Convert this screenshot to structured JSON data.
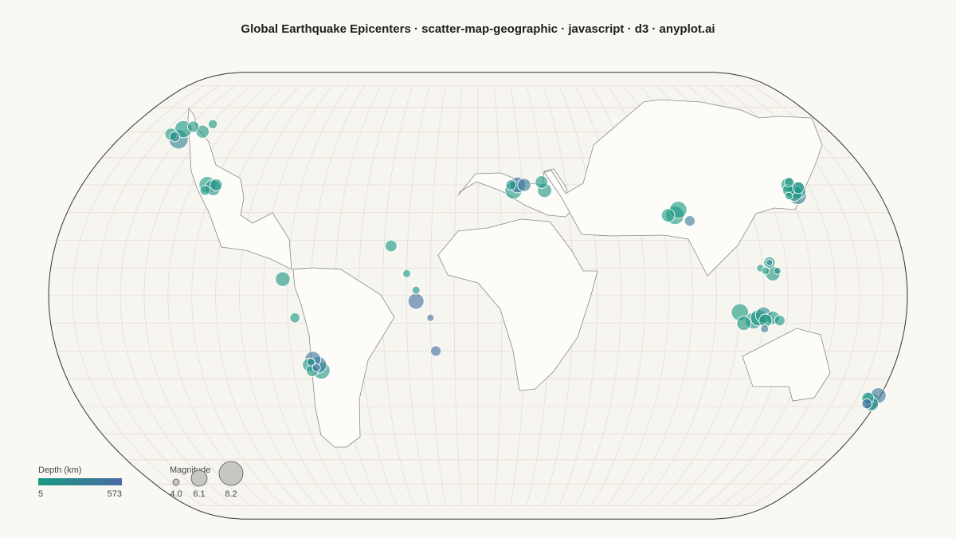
{
  "title": "Global Earthquake Epicenters · scatter-map-geographic · javascript · d3 · anyplot.ai",
  "colors": {
    "background": "#faf8f3",
    "sphere_fill": "#f7f5ef",
    "land_fill": "#fdfcf8",
    "land_stroke": "#8a8a8a",
    "graticule": "#e2dfd6",
    "outline": "#333333",
    "depth_shallow": "#1a9a80",
    "depth_deep": "#4a6aa6"
  },
  "legend": {
    "depth": {
      "title": "Depth (km)",
      "min_label": "5",
      "max_label": "573"
    },
    "magnitude": {
      "title": "Magnitude",
      "labels": [
        "4.0",
        "6.1",
        "8.2"
      ],
      "values": [
        4.0,
        6.1,
        8.2
      ]
    }
  },
  "chart_data": {
    "type": "scatter-map",
    "projection": "Natural Earth",
    "graticule": true,
    "depth_range": [
      5,
      573
    ],
    "magnitude_range": [
      4.0,
      8.2
    ],
    "points": [
      {
        "lon": -152,
        "lat": 61,
        "mag": 6.6,
        "depth": 30
      },
      {
        "lon": -148,
        "lat": 62,
        "mag": 5.2,
        "depth": 60
      },
      {
        "lon": -150,
        "lat": 57,
        "mag": 7.1,
        "depth": 250
      },
      {
        "lon": -156,
        "lat": 59,
        "mag": 5.4,
        "depth": 20
      },
      {
        "lon": -141,
        "lat": 60,
        "mag": 5.6,
        "depth": 35
      },
      {
        "lon": -139,
        "lat": 63,
        "mag": 4.7,
        "depth": 40
      },
      {
        "lon": -153,
        "lat": 58,
        "mag": 4.9,
        "depth": 150
      },
      {
        "lon": -123,
        "lat": 40,
        "mag": 6.5,
        "depth": 20
      },
      {
        "lon": -120,
        "lat": 39,
        "mag": 6.3,
        "depth": 160
      },
      {
        "lon": -119,
        "lat": 40,
        "mag": 5.4,
        "depth": 50
      },
      {
        "lon": -123,
        "lat": 38,
        "mag": 4.9,
        "depth": 12
      },
      {
        "lon": -37,
        "lat": 18,
        "mag": 5.3,
        "depth": 40
      },
      {
        "lon": -82,
        "lat": 6,
        "mag": 6.0,
        "depth": 80
      },
      {
        "lon": -77,
        "lat": -8,
        "mag": 4.9,
        "depth": 40
      },
      {
        "lon": -73,
        "lat": -25,
        "mag": 5.6,
        "depth": 100
      },
      {
        "lon": -71,
        "lat": -23,
        "mag": 6.3,
        "depth": 400
      },
      {
        "lon": -72,
        "lat": -27,
        "mag": 5.4,
        "depth": 30
      },
      {
        "lon": -68,
        "lat": -27,
        "mag": 6.6,
        "depth": 80
      },
      {
        "lon": -69,
        "lat": -25,
        "mag": 6.5,
        "depth": 350
      },
      {
        "lon": -70,
        "lat": -26,
        "mag": 4.4,
        "depth": 450
      },
      {
        "lon": -72,
        "lat": -24,
        "mag": 4.4,
        "depth": 120
      },
      {
        "lon": -30,
        "lat": 8,
        "mag": 4.4,
        "depth": 20
      },
      {
        "lon": -26,
        "lat": 2,
        "mag": 4.4,
        "depth": 50
      },
      {
        "lon": -26,
        "lat": -2,
        "mag": 6.3,
        "depth": 500
      },
      {
        "lon": -20,
        "lat": -8,
        "mag": 4.2,
        "depth": 520
      },
      {
        "lon": -18,
        "lat": -20,
        "mag": 5.0,
        "depth": 480
      },
      {
        "lon": 16,
        "lat": 38,
        "mag": 6.6,
        "depth": 30
      },
      {
        "lon": 18,
        "lat": 40,
        "mag": 6.3,
        "depth": 450
      },
      {
        "lon": 21,
        "lat": 40,
        "mag": 5.6,
        "depth": 350
      },
      {
        "lon": 29,
        "lat": 41,
        "mag": 5.5,
        "depth": 40
      },
      {
        "lon": 30,
        "lat": 38,
        "mag": 5.9,
        "depth": 60
      },
      {
        "lon": 15,
        "lat": 40,
        "mag": 4.9,
        "depth": 25
      },
      {
        "lon": 86,
        "lat": 29,
        "mag": 6.9,
        "depth": 40
      },
      {
        "lon": 88,
        "lat": 31,
        "mag": 6.6,
        "depth": 20
      },
      {
        "lon": 83,
        "lat": 29,
        "mag": 5.7,
        "depth": 15
      },
      {
        "lon": 92,
        "lat": 27,
        "mag": 5.0,
        "depth": 420
      },
      {
        "lon": 140,
        "lat": 38,
        "mag": 5.4,
        "depth": 40
      },
      {
        "lon": 142,
        "lat": 37,
        "mag": 6.3,
        "depth": 70
      },
      {
        "lon": 143,
        "lat": 36,
        "mag": 6.6,
        "depth": 300
      },
      {
        "lon": 144,
        "lat": 38,
        "mag": 6.5,
        "depth": 60
      },
      {
        "lon": 141,
        "lat": 40,
        "mag": 6.0,
        "depth": 30
      },
      {
        "lon": 145,
        "lat": 39,
        "mag": 5.3,
        "depth": 90
      },
      {
        "lon": 142,
        "lat": 41,
        "mag": 4.7,
        "depth": 20
      },
      {
        "lon": 139,
        "lat": 36,
        "mag": 4.3,
        "depth": 50
      },
      {
        "lon": 119,
        "lat": 10,
        "mag": 4.3,
        "depth": 40
      },
      {
        "lon": 121,
        "lat": 9,
        "mag": 4.3,
        "depth": 80
      },
      {
        "lon": 123,
        "lat": 12,
        "mag": 5.2,
        "depth": 60
      },
      {
        "lon": 124,
        "lat": 8,
        "mag": 6.0,
        "depth": 30
      },
      {
        "lon": 123,
        "lat": 12,
        "mag": 4.0,
        "depth": 300
      },
      {
        "lon": 126,
        "lat": 9,
        "mag": 4.2,
        "depth": 100
      },
      {
        "lon": 110,
        "lat": -6,
        "mag": 6.6,
        "depth": 20
      },
      {
        "lon": 112,
        "lat": -10,
        "mag": 5.9,
        "depth": 30
      },
      {
        "lon": 116,
        "lat": -9,
        "mag": 6.5,
        "depth": 70
      },
      {
        "lon": 118,
        "lat": -8,
        "mag": 6.4,
        "depth": 50
      },
      {
        "lon": 120,
        "lat": -7,
        "mag": 6.3,
        "depth": 150
      },
      {
        "lon": 121,
        "lat": -9,
        "mag": 5.6,
        "depth": 40
      },
      {
        "lon": 124,
        "lat": -8,
        "mag": 5.7,
        "depth": 60
      },
      {
        "lon": 121,
        "lat": -12,
        "mag": 4.4,
        "depth": 400
      },
      {
        "lon": 127,
        "lat": -9,
        "mag": 5.0,
        "depth": 30
      },
      {
        "lon": 175,
        "lat": -37,
        "mag": 5.4,
        "depth": 30
      },
      {
        "lon": 177,
        "lat": -38,
        "mag": 6.6,
        "depth": 80
      },
      {
        "lon": 179,
        "lat": -36,
        "mag": 6.2,
        "depth": 400
      },
      {
        "lon": 178,
        "lat": -39,
        "mag": 5.9,
        "depth": 150
      },
      {
        "lon": 176,
        "lat": -39,
        "mag": 4.9,
        "depth": 500
      }
    ]
  }
}
